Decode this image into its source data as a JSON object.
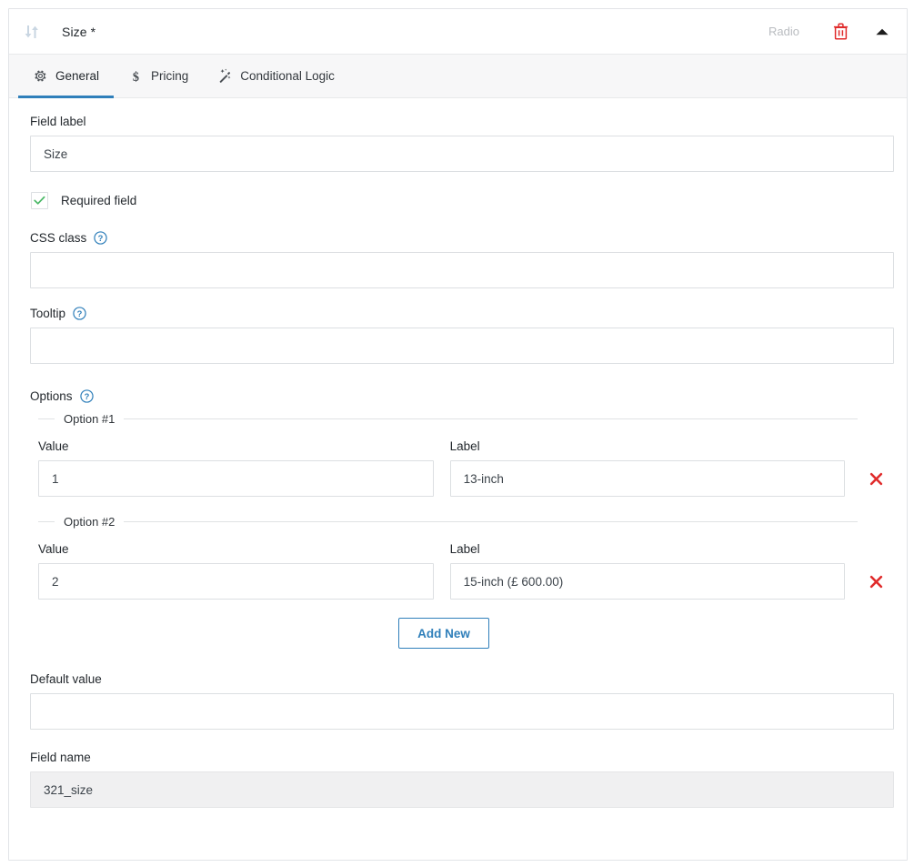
{
  "header": {
    "field_title": "Size *",
    "field_type": "Radio",
    "drag_icon": "sort-drag-icon",
    "delete_icon": "trash-icon",
    "collapse_icon": "chevron-up-icon"
  },
  "tabs": [
    {
      "label": "General",
      "icon": "gear-icon",
      "active": true
    },
    {
      "label": "Pricing",
      "icon": "dollar-icon",
      "active": false
    },
    {
      "label": "Conditional Logic",
      "icon": "magic-wand-icon",
      "active": false
    }
  ],
  "form": {
    "field_label": {
      "label": "Field label",
      "value": "Size",
      "placeholder": ""
    },
    "required": {
      "label": "Required field",
      "checked": true
    },
    "css_class": {
      "label": "CSS class",
      "value": "",
      "placeholder": "",
      "help_icon": "question-circle-icon"
    },
    "tooltip": {
      "label": "Tooltip",
      "value": "",
      "placeholder": "",
      "help_icon": "question-circle-icon"
    },
    "options": {
      "label": "Options",
      "help_icon": "question-circle-icon",
      "value_column_label": "Value",
      "label_column_label": "Label",
      "remove_icon": "red-x-icon",
      "items": [
        {
          "legend": "Option #1",
          "value": "1",
          "label": "13-inch"
        },
        {
          "legend": "Option #2",
          "value": "2",
          "label": "15-inch (£ 600.00)"
        }
      ],
      "add_new_label": "Add New"
    },
    "default_value": {
      "label": "Default value",
      "value": "",
      "placeholder": ""
    },
    "field_name": {
      "label": "Field name",
      "value": "321_size",
      "placeholder": "",
      "readonly": true
    }
  },
  "colors": {
    "accent": "#2f7fba",
    "danger": "#e02b2b",
    "success": "#4ab866",
    "muted": "#b9bcc0"
  }
}
